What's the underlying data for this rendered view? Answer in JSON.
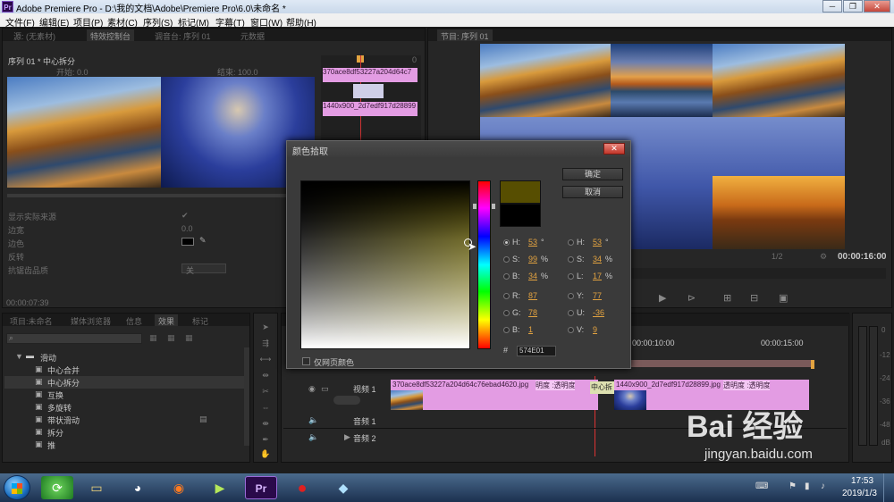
{
  "window": {
    "title": "Adobe Premiere Pro - D:\\我的文档\\Adobe\\Premiere Pro\\6.0\\未命名 *",
    "logo": "Pr",
    "controls": [
      "─",
      "❐",
      "✕"
    ]
  },
  "menu": [
    "文件(F)",
    "编辑(E)",
    "项目(P)",
    "素材(C)",
    "序列(S)",
    "标记(M)",
    "字幕(T)",
    "窗口(W)",
    "帮助(H)"
  ],
  "source_panel": {
    "tabs": [
      "源: (无素材)",
      "特效控制台",
      "调音台: 序列 01",
      "元数据"
    ],
    "header": "序列 01 * 中心拆分",
    "sub_left": "开始: 0.0",
    "sub_right": "结束: 100.0",
    "ruler_marker": "0",
    "clip_a": "370ace8df53227a204d64c7",
    "clip_b": "1440x900_2d7edf917d28899",
    "props": [
      {
        "label": "显示实际来源",
        "value": "✔"
      },
      {
        "label": "边宽",
        "value": "0.0"
      },
      {
        "label": "边色",
        "value": ""
      },
      {
        "label": "反转",
        "value": ""
      },
      {
        "label": "抗锯齿品质",
        "value": "关"
      }
    ],
    "timecode": "00:00:07:39"
  },
  "program_panel": {
    "tabs": [
      "节目: 序列 01"
    ],
    "zoom": "1/2",
    "timecode": "00:00:16:00"
  },
  "color_picker": {
    "title": "颜色拾取",
    "ok_label": "确定",
    "cancel_label": "取消",
    "hsb": [
      {
        "label": "H:",
        "value": "53",
        "unit": "°",
        "selected": true
      },
      {
        "label": "S:",
        "value": "99",
        "unit": "%",
        "selected": false
      },
      {
        "label": "B:",
        "value": "34",
        "unit": "%",
        "selected": false
      }
    ],
    "hsl": [
      {
        "label": "H:",
        "value": "53",
        "unit": "°"
      },
      {
        "label": "S:",
        "value": "34",
        "unit": "%"
      },
      {
        "label": "L:",
        "value": "17",
        "unit": "%"
      }
    ],
    "rgb": [
      {
        "label": "R:",
        "value": "87"
      },
      {
        "label": "G:",
        "value": "78"
      },
      {
        "label": "B:",
        "value": "1"
      }
    ],
    "yuv": [
      {
        "label": "Y:",
        "value": "77"
      },
      {
        "label": "U:",
        "value": "-36"
      },
      {
        "label": "V:",
        "value": "9"
      }
    ],
    "hash": "#",
    "hex": "574E01",
    "web_only_label": "仅网页颜色",
    "new_color": "#574E01",
    "old_color": "#000000"
  },
  "project_panel": {
    "tabs": [
      "项目:未命名",
      "媒体浏览器",
      "信息",
      "效果",
      "标记"
    ],
    "folder": "滑动",
    "items": [
      "中心合并",
      "中心拆分",
      "互换",
      "多旋转",
      "带状滑动",
      "拆分",
      "推"
    ]
  },
  "timeline": {
    "ruler_labels": [
      "00:00:10:00",
      "00:00:15:00"
    ],
    "tracks": [
      {
        "name": "视频 1"
      },
      {
        "name": "音频 1"
      },
      {
        "name": "音频 2"
      }
    ],
    "clip1_label": "370ace8df53227a204d64c76ebad4620.jpg",
    "clip1_opacity": "明度 :透明度",
    "transition_label": "中心拆",
    "clip2_label": "1440x900_2d7edf917d28899.jpg",
    "clip2_opacity": "透明度 :透明度"
  },
  "meters": {
    "scale": [
      "0",
      "-12",
      "-24",
      "-36",
      "-48",
      "dB"
    ]
  },
  "taskbar": {
    "time": "17:53",
    "date": "2019/1/3"
  },
  "watermark": {
    "brand": "Bai 经验",
    "url": "jingyan.baidu.com"
  }
}
